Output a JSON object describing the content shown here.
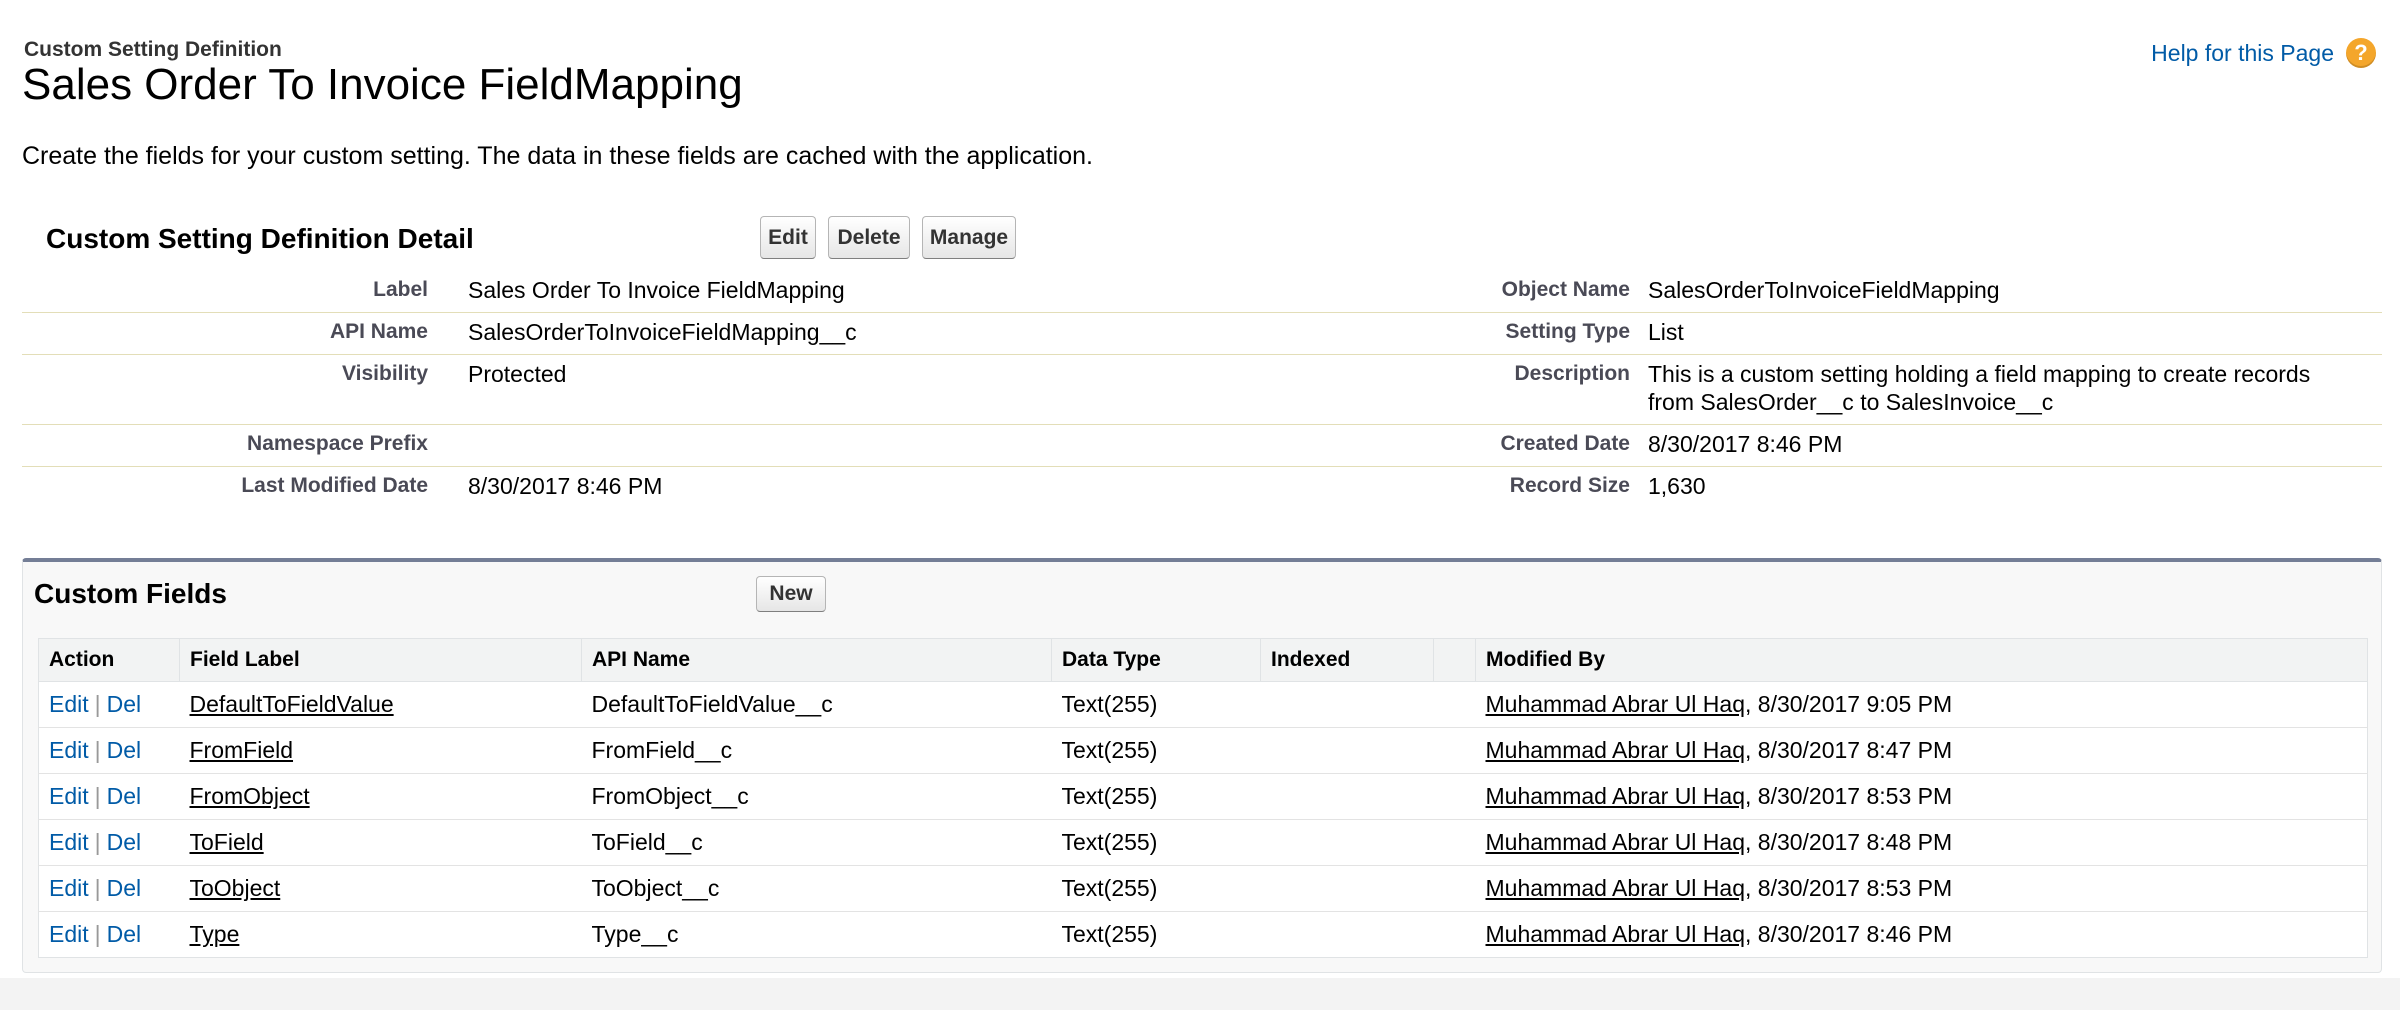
{
  "header": {
    "subtitle": "Custom Setting Definition",
    "title": "Sales Order To Invoice FieldMapping",
    "help_link": "Help for this Page",
    "help_icon_glyph": "?",
    "description": "Create the fields for your custom setting. The data in these fields are cached with the application."
  },
  "detail": {
    "section_title": "Custom Setting Definition Detail",
    "buttons": {
      "edit": "Edit",
      "delete": "Delete",
      "manage": "Manage"
    },
    "rows": [
      {
        "left_label": "Label",
        "left_value": "Sales Order To Invoice FieldMapping",
        "right_label": "Object Name",
        "right_value": "SalesOrderToInvoiceFieldMapping"
      },
      {
        "left_label": "API Name",
        "left_value": "SalesOrderToInvoiceFieldMapping__c",
        "right_label": "Setting Type",
        "right_value": "List"
      },
      {
        "left_label": "Visibility",
        "left_value": "Protected",
        "right_label": "Description",
        "right_value": "This is a custom setting holding a field mapping to create records",
        "right_value_2": "from SalesOrder__c to SalesInvoice__c"
      },
      {
        "left_label": "Namespace Prefix",
        "left_value": "",
        "right_label": "Created Date",
        "right_value": "8/30/2017 8:46 PM"
      },
      {
        "left_label": "Last Modified Date",
        "left_value": "8/30/2017 8:46 PM",
        "right_label": "Record Size",
        "right_value": "1,630"
      }
    ]
  },
  "custom_fields": {
    "section_title": "Custom Fields",
    "new_button": "New",
    "columns": [
      "Action",
      "Field Label",
      "API Name",
      "Data Type",
      "Indexed",
      "",
      "Modified By"
    ],
    "action_edit": "Edit",
    "action_separator": "|",
    "action_del": "Del",
    "rows": [
      {
        "field_label": "DefaultToFieldValue",
        "api_name": "DefaultToFieldValue__c",
        "data_type": "Text(255)",
        "indexed": "",
        "modified_by": "Muhammad Abrar Ul Haq",
        "modified_date": ", 8/30/2017 9:05 PM"
      },
      {
        "field_label": "FromField",
        "api_name": "FromField__c",
        "data_type": "Text(255)",
        "indexed": "",
        "modified_by": "Muhammad Abrar Ul Haq",
        "modified_date": ", 8/30/2017 8:47 PM"
      },
      {
        "field_label": "FromObject",
        "api_name": "FromObject__c",
        "data_type": "Text(255)",
        "indexed": "",
        "modified_by": "Muhammad Abrar Ul Haq",
        "modified_date": ", 8/30/2017 8:53 PM"
      },
      {
        "field_label": "ToField",
        "api_name": "ToField__c",
        "data_type": "Text(255)",
        "indexed": "",
        "modified_by": "Muhammad Abrar Ul Haq",
        "modified_date": ", 8/30/2017 8:48 PM"
      },
      {
        "field_label": "ToObject",
        "api_name": "ToObject__c",
        "data_type": "Text(255)",
        "indexed": "",
        "modified_by": "Muhammad Abrar Ul Haq",
        "modified_date": ", 8/30/2017 8:53 PM"
      },
      {
        "field_label": "Type",
        "api_name": "Type__c",
        "data_type": "Text(255)",
        "indexed": "",
        "modified_by": "Muhammad Abrar Ul Haq",
        "modified_date": ", 8/30/2017 8:46 PM"
      }
    ]
  },
  "colors": {
    "link": "#015ba7",
    "help_icon": "#f4a62b",
    "related_list_border": "#747e96"
  }
}
